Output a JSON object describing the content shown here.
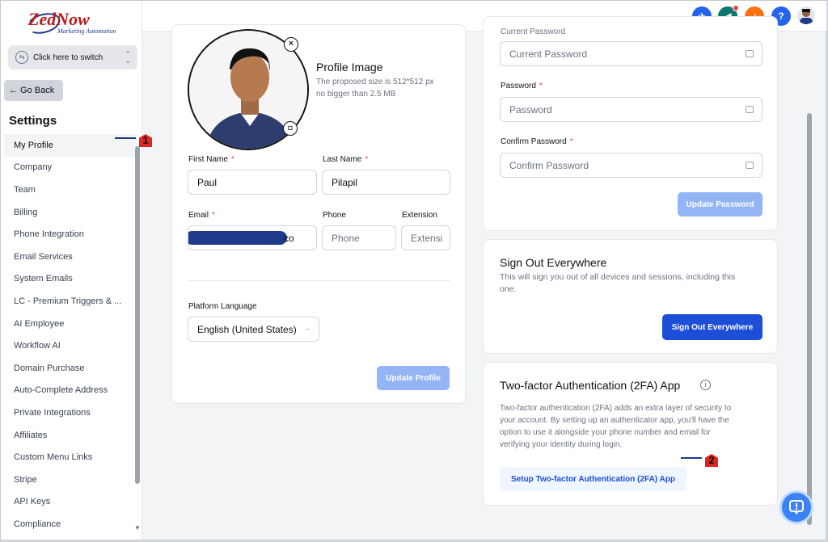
{
  "brand": {
    "name": "ZedNow",
    "tagline": "Marketing Automation"
  },
  "switcher": {
    "label": "Click here to switch"
  },
  "go_back": "← Go Back",
  "settings_title": "Settings",
  "nav": [
    "My Profile",
    "Company",
    "Team",
    "Billing",
    "Phone Integration",
    "Email Services",
    "System Emails",
    "LC - Premium Triggers & ...",
    "AI Employee",
    "Workflow AI",
    "Domain Purchase",
    "Auto-Complete Address",
    "Private Integrations",
    "Affiliates",
    "Custom Menu Links",
    "Stripe",
    "API Keys",
    "Compliance"
  ],
  "topbar": {
    "icons": [
      "rocket-icon",
      "megaphone-icon",
      "bell-icon",
      "help-icon"
    ],
    "help": "?",
    "colors": [
      "#2563eb",
      "#0f766e",
      "#f97316",
      "#2563eb"
    ]
  },
  "profile": {
    "image_title": "Profile Image",
    "image_hint1": "The proposed size is 512*512 px",
    "image_hint2": "no bigger than 2.5 MB",
    "first_name_label": "First Name",
    "first_name": "Paul",
    "last_name_label": "Last Name",
    "last_name": "Pilapil",
    "email_label": "Email",
    "email_suffix": "co",
    "phone_label": "Phone",
    "phone_placeholder": "Phone",
    "extension_label": "Extension",
    "extension_placeholder": "Extensi",
    "language_label": "Platform Language",
    "language_value": "English (United States)",
    "update_button": "Update Profile",
    "required": "*"
  },
  "password": {
    "current_label": "Current Password",
    "current_placeholder": "Current Password",
    "password_label": "Password",
    "password_placeholder": "Password",
    "confirm_label": "Confirm Password",
    "confirm_placeholder": "Confirm Password",
    "update_button": "Update Password"
  },
  "signout": {
    "title": "Sign Out Everywhere",
    "desc1": "This will sign you out of all devices and sessions, including this",
    "desc2": "one.",
    "button": "Sign Out Everywhere"
  },
  "twofa": {
    "title": "Two-factor Authentication (2FA) App",
    "desc1": "Two-factor authentication (2FA) adds an extra layer of security to",
    "desc2": "your account. By setting up an authenticator app, you'll have the",
    "desc3": "option to use it alongside your phone number and email for",
    "desc4": "verifying your identity during login.",
    "button": "Setup Two-factor Authentication (2FA) App"
  },
  "markers": {
    "one": "1",
    "two": "2"
  }
}
